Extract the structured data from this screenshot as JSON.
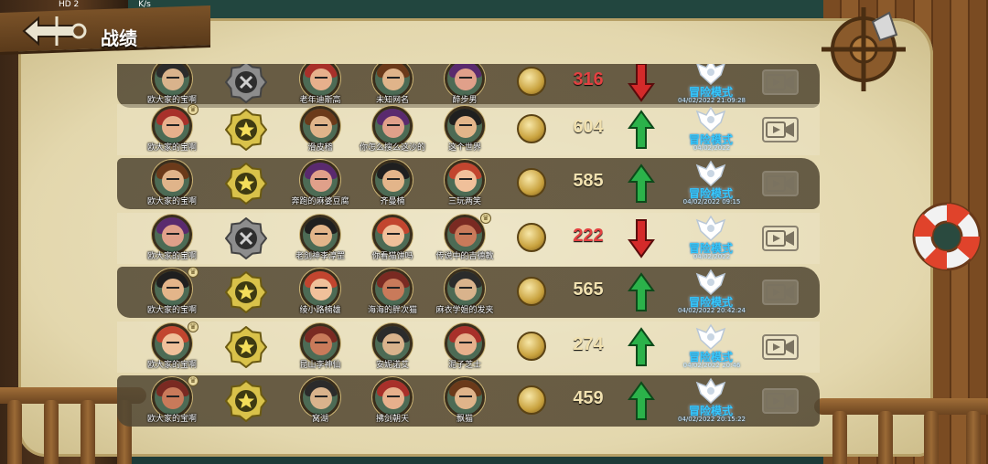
{
  "header": {
    "title": "战绩",
    "status_left": "HD 2",
    "status_right": "K/s"
  },
  "colors": {
    "win_score": "#f1e1b0",
    "lose_score": "#e24141",
    "mode_text": "#36c9ff",
    "arrow_up": "#2bb24a",
    "arrow_down": "#d42a2a"
  },
  "icons": [
    "back-anchor-icon",
    "ship-wheel-icon",
    "lifebuoy-icon",
    "win-star-badge-icon",
    "lose-x-badge-icon",
    "coin-icon",
    "arrow-up-icon",
    "arrow-down-icon",
    "adventure-mode-emblem-icon",
    "replay-video-icon",
    "crown-badge-icon"
  ],
  "rows": [
    {
      "result": "lose",
      "player": {
        "name": "欧大家的宝啊",
        "crown": false
      },
      "heroes": [
        {
          "name": "老年迪斯高",
          "crown": false
        },
        {
          "name": "未知网名",
          "crown": false
        },
        {
          "name": "醉步男",
          "crown": false
        }
      ],
      "score": "316",
      "trend": "down",
      "mode": "冒险模式",
      "time": "04/02/2022 21:09:28"
    },
    {
      "result": "win",
      "player": {
        "name": "欧大家的宝啊",
        "crown": true
      },
      "heroes": [
        {
          "name": "滑皮稽",
          "crown": false
        },
        {
          "name": "你怎么搜么这沙的",
          "crown": false
        },
        {
          "name": "这个世界",
          "crown": false
        }
      ],
      "score": "604",
      "trend": "up",
      "mode": "冒险模式",
      "time": "04/02/2022"
    },
    {
      "result": "win",
      "player": {
        "name": "欧大家的宝啊",
        "crown": false
      },
      "heroes": [
        {
          "name": "奔跑的麻婆豆腐",
          "crown": false
        },
        {
          "name": "齐曼楠",
          "crown": false
        },
        {
          "name": "三玩两笑",
          "crown": false
        }
      ],
      "score": "585",
      "trend": "up",
      "mode": "冒险模式",
      "time": "04/02/2022 09:15"
    },
    {
      "result": "lose",
      "player": {
        "name": "欧大家的宝啊",
        "crown": false
      },
      "heroes": [
        {
          "name": "老剑神李淳罡",
          "crown": false
        },
        {
          "name": "你看猫饼吗",
          "crown": false
        },
        {
          "name": "传说中的吉德教",
          "crown": true
        }
      ],
      "score": "222",
      "trend": "down",
      "mode": "冒险模式",
      "time": "04/02/2022"
    },
    {
      "result": "win",
      "player": {
        "name": "欧大家的宝啊",
        "crown": true
      },
      "heroes": [
        {
          "name": "绫小路楠雄",
          "crown": false
        },
        {
          "name": "海海的胖次猫",
          "crown": false
        },
        {
          "name": "麻衣学姐的发夹",
          "crown": false
        }
      ],
      "score": "565",
      "trend": "up",
      "mode": "冒险模式",
      "time": "04/02/2022 20:42:24"
    },
    {
      "result": "win",
      "player": {
        "name": "欧大家的宝啊",
        "crown": true
      },
      "heroes": [
        {
          "name": "昆山李神仙",
          "crown": false
        },
        {
          "name": "安妮诺艾",
          "crown": false
        },
        {
          "name": "泥子芝士",
          "crown": false
        }
      ],
      "score": "274",
      "trend": "up",
      "mode": "冒险模式",
      "time": "04/02/2022 20:46"
    },
    {
      "result": "win",
      "player": {
        "name": "欧大家的宝啊",
        "crown": true
      },
      "heroes": [
        {
          "name": "窝湖",
          "crown": false
        },
        {
          "name": "拂剑朝天",
          "crown": false
        },
        {
          "name": "飘猫",
          "crown": false
        }
      ],
      "score": "459",
      "trend": "up",
      "mode": "冒险模式",
      "time": "04/02/2022 20:15:22"
    }
  ]
}
